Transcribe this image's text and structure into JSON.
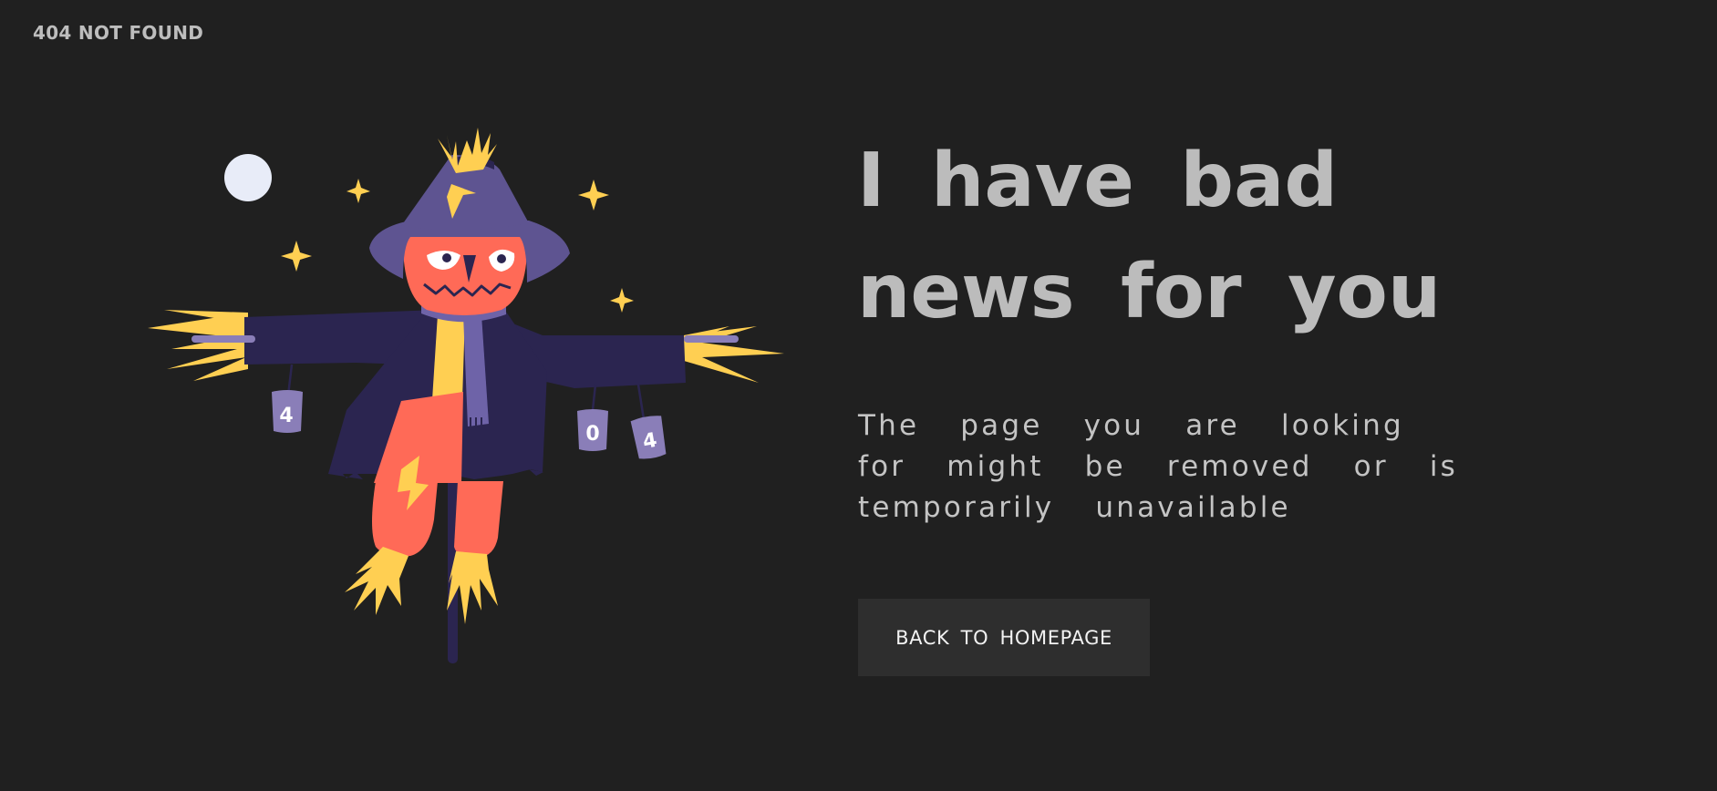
{
  "brand": {
    "label": "404 NOT FOUND"
  },
  "illustration": {
    "subject": "scarecrow",
    "can_labels": [
      "4",
      "0",
      "4"
    ],
    "colors": {
      "moon": "#e8ecf8",
      "star": "#ffcf52",
      "hat": "#5e5491",
      "head": "#ff6a57",
      "coat": "#2b2550",
      "scarf": "#6e63a8",
      "straw": "#ffcf52",
      "can": "#8a7eb8"
    }
  },
  "content": {
    "headline": "I have bad news for you",
    "message": "The page you are looking for might be removed or is temporarily unavailable",
    "button_label": "BACK TO HOMEPAGE"
  },
  "theme": {
    "background": "#202020",
    "headline_color": "#bcbcbc",
    "text_color": "#c4c4c4",
    "button_background": "#2e2e2e",
    "button_text": "#f2f2f2"
  }
}
